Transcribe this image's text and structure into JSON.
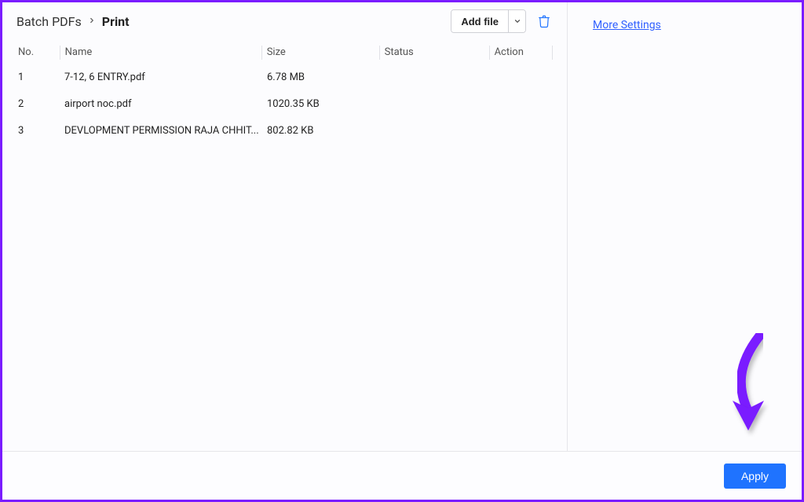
{
  "breadcrumb": {
    "root": "Batch PDFs",
    "current": "Print"
  },
  "toolbar": {
    "add_file_label": "Add file"
  },
  "table": {
    "headers": {
      "no": "No.",
      "name": "Name",
      "size": "Size",
      "status": "Status",
      "action": "Action"
    },
    "rows": [
      {
        "no": "1",
        "name": "7-12, 6 ENTRY.pdf",
        "size": "6.78 MB",
        "status": "",
        "action": ""
      },
      {
        "no": "2",
        "name": "airport noc.pdf",
        "size": "1020.35 KB",
        "status": "",
        "action": ""
      },
      {
        "no": "3",
        "name": "DEVLOPMENT PERMISSION RAJA CHHIT...",
        "size": "802.82 KB",
        "status": "",
        "action": ""
      }
    ]
  },
  "right_panel": {
    "more_settings": "More Settings"
  },
  "footer": {
    "apply_label": "Apply"
  }
}
